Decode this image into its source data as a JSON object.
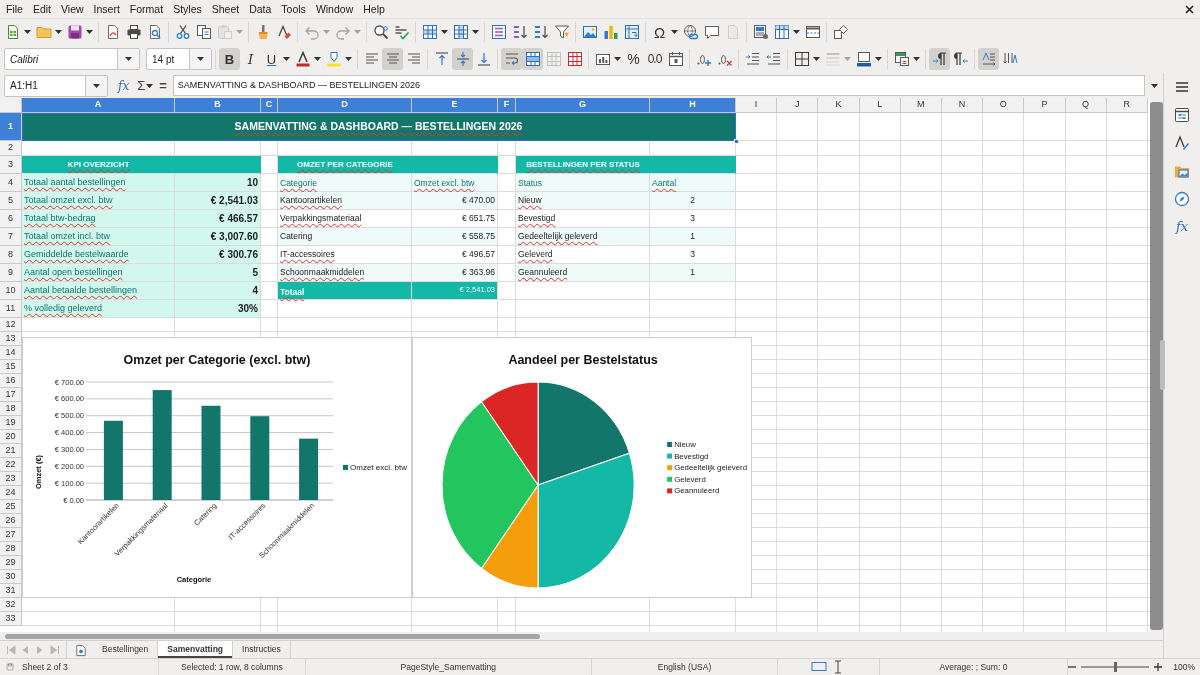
{
  "menu_bar": [
    "File",
    "Edit",
    "View",
    "Insert",
    "Format",
    "Styles",
    "Sheet",
    "Data",
    "Tools",
    "Window",
    "Help"
  ],
  "standard_toolbar": {
    "special_character": "Ω",
    "paste_disabled": true,
    "undo_disabled": true,
    "redo_disabled": true,
    "page_disabled": true
  },
  "formatting_toolbar": {
    "font_name": "Calibri",
    "font_size": "14 pt",
    "bold": {
      "label": "B",
      "on": true
    },
    "italic": {
      "label": "I",
      "on": false
    },
    "underline": {
      "label": "U",
      "on": false
    },
    "align_left_on": false,
    "align_center_on": true,
    "align_right_on": false,
    "align_top_on": false,
    "align_middle_on": true,
    "align_bottom_on": false,
    "wrap_text_on": true,
    "merge_center_on": true,
    "merge_disabled": true,
    "percent": "%",
    "decimal": "0.0",
    "border_style_disabled": true,
    "left_to_right_on": true,
    "right_to_left_on": false,
    "text_horizontal_on": true,
    "text_vertical_on": false
  },
  "formula_bar": {
    "name_box": "A1:H1",
    "function_wizard": "fx",
    "sum": "Σ",
    "equals": "=",
    "content": "SAMENVATTING & DASHBOARD — BESTELLINGEN 2026"
  },
  "sidebar": {
    "functions": "fx"
  },
  "sheet": {
    "column_headers": [
      {
        "label": "A",
        "selected": true
      },
      {
        "label": "B",
        "selected": true
      },
      {
        "label": "C",
        "selected": true
      },
      {
        "label": "D",
        "selected": true
      },
      {
        "label": "E",
        "selected": true
      },
      {
        "label": "F",
        "selected": true
      },
      {
        "label": "G",
        "selected": true
      },
      {
        "label": "H",
        "selected": true
      },
      {
        "label": "I",
        "selected": false
      },
      {
        "label": "J",
        "selected": false
      },
      {
        "label": "K",
        "selected": false
      },
      {
        "label": "L",
        "selected": false
      },
      {
        "label": "M",
        "selected": false
      },
      {
        "label": "N",
        "selected": false
      },
      {
        "label": "O",
        "selected": false
      },
      {
        "label": "P",
        "selected": false
      },
      {
        "label": "Q",
        "selected": false
      },
      {
        "label": "R",
        "selected": false
      }
    ],
    "row_headers": [
      {
        "label": "1",
        "selected": true
      },
      {
        "label": "2",
        "selected": false
      },
      {
        "label": "3",
        "selected": false
      },
      {
        "label": "4",
        "selected": false
      },
      {
        "label": "5",
        "selected": false
      },
      {
        "label": "6",
        "selected": false
      },
      {
        "label": "7",
        "selected": false
      },
      {
        "label": "8",
        "selected": false
      },
      {
        "label": "9",
        "selected": false
      },
      {
        "label": "10",
        "selected": false
      },
      {
        "label": "11",
        "selected": false
      },
      {
        "label": "12",
        "selected": false
      },
      {
        "label": "13",
        "selected": false
      },
      {
        "label": "14",
        "selected": false
      },
      {
        "label": "15",
        "selected": false
      },
      {
        "label": "16",
        "selected": false
      },
      {
        "label": "17",
        "selected": false
      },
      {
        "label": "18",
        "selected": false
      },
      {
        "label": "19",
        "selected": false
      },
      {
        "label": "20",
        "selected": false
      },
      {
        "label": "21",
        "selected": false
      },
      {
        "label": "22",
        "selected": false
      },
      {
        "label": "23",
        "selected": false
      },
      {
        "label": "24",
        "selected": false
      },
      {
        "label": "25",
        "selected": false
      },
      {
        "label": "26",
        "selected": false
      },
      {
        "label": "27",
        "selected": false
      },
      {
        "label": "28",
        "selected": false
      },
      {
        "label": "29",
        "selected": false
      },
      {
        "label": "30",
        "selected": false
      },
      {
        "label": "31",
        "selected": false
      },
      {
        "label": "32",
        "selected": false
      },
      {
        "label": "33",
        "selected": false
      }
    ],
    "title": {
      "text": "SAMENVATTING & DASHBOARD — BESTELLINGEN 2026",
      "selected": true,
      "spell_error": true
    },
    "kpi_table": {
      "header": {
        "text": "KPI OVERZICHT",
        "spell_error": true
      },
      "rows": [
        {
          "label": "Totaal aantal bestellingen",
          "value": "10",
          "spell_error": true
        },
        {
          "label": "Totaal omzet excl. btw",
          "value": "€ 2,541.03",
          "spell_error": true
        },
        {
          "label": "Totaal btw-bedrag",
          "value": "€ 466.57",
          "spell_error": true
        },
        {
          "label": "Totaal omzet incl. btw",
          "value": "€ 3,007.60",
          "spell_error": true
        },
        {
          "label": "Gemiddelde bestelwaarde",
          "value": "€ 300.76",
          "spell_error": true
        },
        {
          "label": "Aantal open bestellingen",
          "value": "5",
          "spell_error": true
        },
        {
          "label": "Aantal betaalde bestellingen",
          "value": "4",
          "spell_error": true
        },
        {
          "label": "% volledig geleverd",
          "value": "30%",
          "spell_error": true
        }
      ]
    },
    "category_table": {
      "header": {
        "text": "OMZET PER CATEGORIE",
        "spell_error": true
      },
      "columns": [
        {
          "text": "Categorie",
          "spell_error": true
        },
        {
          "text": "Omzet excl. btw",
          "spell_error": true
        }
      ],
      "rows": [
        {
          "name": "Kantoorartikelen",
          "amount": "€ 470.00",
          "spell_error": true
        },
        {
          "name": "Verpakkingsmateriaal",
          "amount": "€ 651.75",
          "spell_error": true
        },
        {
          "name": "Catering",
          "amount": "€ 558.75",
          "spell_error": false
        },
        {
          "name": "IT-accessoires",
          "amount": "€ 496.57",
          "spell_error": true
        },
        {
          "name": "Schoonmaakmiddelen",
          "amount": "€ 363.96",
          "spell_error": true
        }
      ],
      "total": {
        "label": "Totaal",
        "value": "€ 2,541.03",
        "spell_error": true
      }
    },
    "status_table": {
      "header": {
        "text": "BESTELLINGEN PER STATUS",
        "spell_error": true
      },
      "columns": [
        {
          "text": "Status",
          "spell_error": false
        },
        {
          "text": "Aantal",
          "spell_error": true
        }
      ],
      "rows": [
        {
          "name": "Nieuw",
          "count": "2",
          "spell_error": true
        },
        {
          "name": "Bevestigd",
          "count": "3",
          "spell_error": true
        },
        {
          "name": "Gedeeltelijk geleverd",
          "count": "1",
          "spell_error": true
        },
        {
          "name": "Geleverd",
          "count": "3",
          "spell_error": true
        },
        {
          "name": "Geannuleerd",
          "count": "1",
          "spell_error": true
        }
      ]
    }
  },
  "bar_chart": {
    "chart_data": {
      "type": "bar",
      "title": "Omzet per Categorie (excl. btw)",
      "xlabel": "Categorie",
      "ylabel": "Omzet (€)",
      "categories": [
        "Kantoorartikelen",
        "Verpakkingsmateriaal",
        "Catering",
        "IT-accessoires",
        "Schoonmaakmiddelen"
      ],
      "series": [
        {
          "name": "Omzet excl. btw",
          "color": "#13766b",
          "values": [
            470,
            652,
            559,
            497,
            364
          ]
        }
      ],
      "ylim": [
        0,
        700
      ],
      "yticks": [
        {
          "value": 0,
          "label": "€ 0.00"
        },
        {
          "value": 100,
          "label": "€ 100.00"
        },
        {
          "value": 200,
          "label": "€ 200.00"
        },
        {
          "value": 300,
          "label": "€ 300.00"
        },
        {
          "value": 400,
          "label": "€ 400.00"
        },
        {
          "value": 500,
          "label": "€ 500.00"
        },
        {
          "value": 600,
          "label": "€ 600.00"
        },
        {
          "value": 700,
          "label": "€ 700.00"
        }
      ],
      "grid": true,
      "legend": "right"
    }
  },
  "pie_chart": {
    "chart_data": {
      "type": "pie",
      "title": "Aandeel per Bestelstatus",
      "categories": [
        "Nieuw",
        "Bevestigd",
        "Gedeeltelijk geleverd",
        "Geleverd",
        "Geannuleerd"
      ],
      "values": [
        20,
        30,
        10,
        30,
        10
      ],
      "colors": [
        "#13766b",
        "#14b8a6",
        "#f59e0b",
        "#22c55e",
        "#dc2626"
      ],
      "legend": "right"
    }
  },
  "sheet_tabs": {
    "navigation_disabled": true,
    "tabs": [
      {
        "label": "Bestellingen",
        "selected": false
      },
      {
        "label": "Samenvatting",
        "selected": true
      },
      {
        "label": "Instructies",
        "selected": false
      }
    ]
  },
  "status_bar": {
    "sheet": "Sheet 2 of 3",
    "selection": "Selected: 1 row, 8 columns",
    "page_style": "PageStyle_Samenvatting",
    "language": "English (USA)",
    "summary": "Average: ; Sum: 0",
    "zoom_slider": {
      "level": 0.5
    },
    "zoom": "100%"
  }
}
